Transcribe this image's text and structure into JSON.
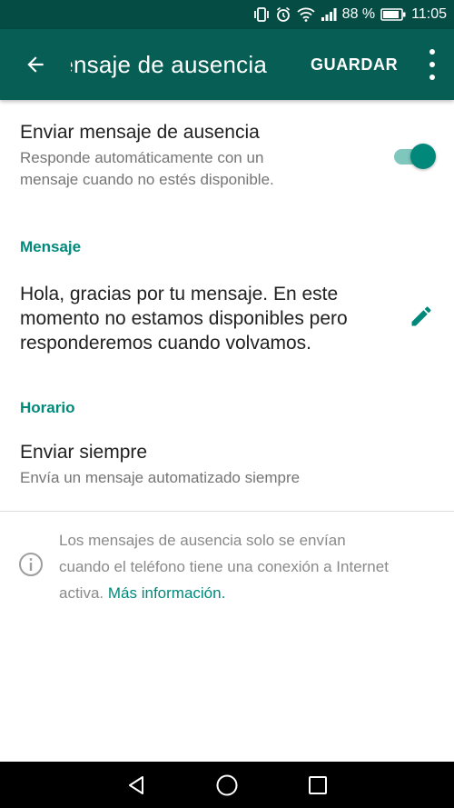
{
  "status_bar": {
    "battery_text": "88 %",
    "time": "11:05",
    "icons": [
      "vibrate-icon",
      "alarm-icon",
      "wifi-icon",
      "signal-icon",
      "battery-icon"
    ]
  },
  "app_bar": {
    "title": "Mensaje de ausencia",
    "save_label": "GUARDAR",
    "back_icon": "arrow-back-icon",
    "menu_icon": "more-vert-icon",
    "background": "#075e54"
  },
  "away_toggle": {
    "title": "Enviar mensaje de ausencia",
    "subtitle_line1": "Responde automáticamente con un",
    "subtitle_line2": "mensaje cuando no estés disponible.",
    "enabled": true,
    "accent": "#00897b"
  },
  "message_section": {
    "header": "Mensaje",
    "line1": "Hola, gracias por tu mensaje. En este",
    "line2": "momento no estamos disponibles pero",
    "line3": "responderemos cuando volvamos.",
    "edit_icon": "pencil-icon"
  },
  "schedule_section": {
    "header": "Horario",
    "title": "Enviar siempre",
    "subtitle": "Envía un mensaje automatizado siempre"
  },
  "info": {
    "icon": "info-icon",
    "line1": "Los mensajes de ausencia solo se envían",
    "line2": "cuando el teléfono tiene una conexión a Internet",
    "line3_prefix": "activa.",
    "link": "Más información."
  },
  "nav_bar": {
    "icons": [
      "nav-back-icon",
      "nav-home-icon",
      "nav-recents-icon"
    ]
  }
}
